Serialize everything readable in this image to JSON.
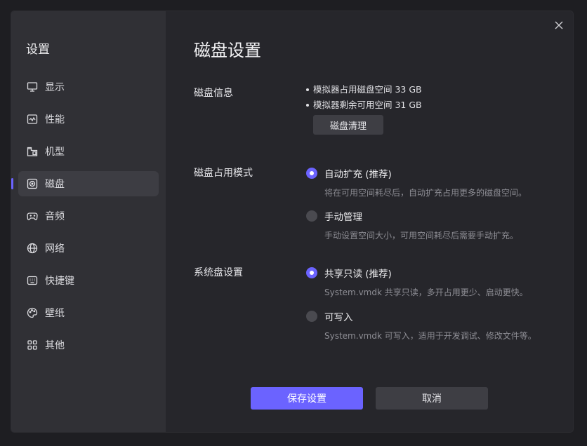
{
  "sidebar": {
    "title": "设置",
    "items": [
      {
        "label": "显示",
        "icon": "monitor-icon"
      },
      {
        "label": "性能",
        "icon": "performance-icon"
      },
      {
        "label": "机型",
        "icon": "device-model-icon"
      },
      {
        "label": "磁盘",
        "icon": "disk-icon",
        "active": true
      },
      {
        "label": "音频",
        "icon": "gamepad-icon"
      },
      {
        "label": "网络",
        "icon": "globe-icon"
      },
      {
        "label": "快捷键",
        "icon": "keyboard-icon"
      },
      {
        "label": "壁纸",
        "icon": "palette-icon"
      },
      {
        "label": "其他",
        "icon": "grid-icon"
      }
    ]
  },
  "main": {
    "title": "磁盘设置",
    "disk_info": {
      "label": "磁盘信息",
      "used": "模拟器占用磁盘空间 33 GB",
      "free": "模拟器剩余可用空间 31 GB",
      "clean_button": "磁盘清理"
    },
    "disk_mode": {
      "label": "磁盘占用模式",
      "options": [
        {
          "label": "自动扩充 (推荐)",
          "desc": "将在可用空间耗尽后，自动扩充占用更多的磁盘空间。",
          "selected": true
        },
        {
          "label": "手动管理",
          "desc": "手动设置空间大小，可用空间耗尽后需要手动扩充。",
          "selected": false
        }
      ]
    },
    "system_disk": {
      "label": "系统盘设置",
      "options": [
        {
          "label": "共享只读 (推荐)",
          "desc": "System.vmdk 共享只读，多开占用更少、启动更快。",
          "selected": true
        },
        {
          "label": "可写入",
          "desc": "System.vmdk 可写入，适用于开发调试、修改文件等。",
          "selected": false
        }
      ]
    },
    "save_button": "保存设置",
    "cancel_button": "取消"
  },
  "colors": {
    "accent": "#6b63ff",
    "sidebar_bg": "#303035",
    "main_bg": "#26262b"
  }
}
